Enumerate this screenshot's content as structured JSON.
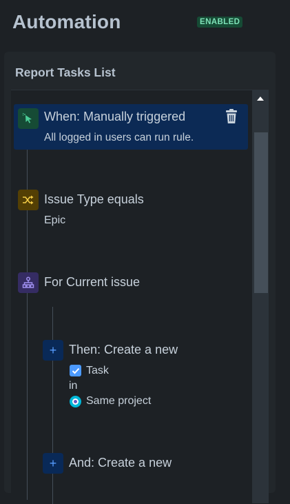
{
  "header": {
    "title": "Automation",
    "status_badge": "ENABLED"
  },
  "panel": {
    "title": "Report Tasks List"
  },
  "rules": {
    "trigger": {
      "title": "When: Manually triggered",
      "subtitle": "All logged in users can run rule.",
      "icon": "cursor-click-icon",
      "icon_bg": "#164b35",
      "selected_bg": "#0c2a55"
    },
    "condition": {
      "title": "Issue Type equals",
      "value": "Epic",
      "icon": "shuffle-icon",
      "icon_bg": "#533f04"
    },
    "branch": {
      "title": "For Current issue",
      "icon": "branch-icon",
      "icon_bg": "#352c63"
    },
    "action1": {
      "title": "Then: Create a new",
      "issue_type": "Task",
      "connector": "in",
      "project": "Same project",
      "icon": "plus-icon"
    },
    "action2": {
      "title": "And: Create a new",
      "icon": "plus-icon"
    }
  }
}
